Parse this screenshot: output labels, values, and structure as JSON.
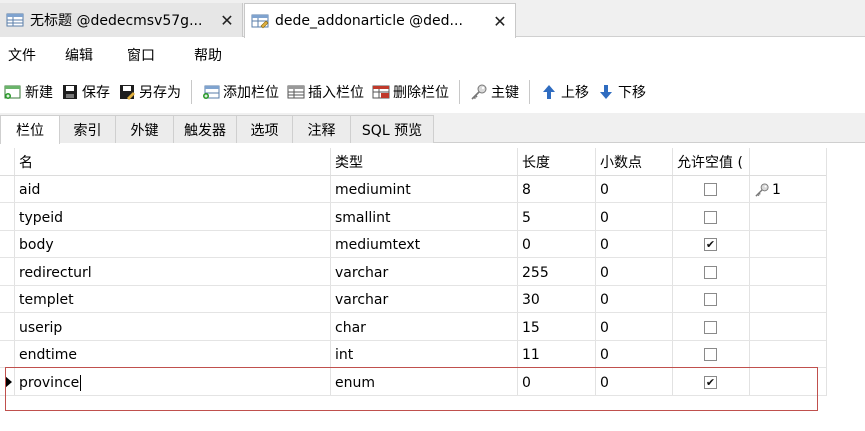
{
  "tabs": [
    {
      "label": "无标题 @dedecmsv57g...",
      "close": "✕"
    },
    {
      "label": "dede_addonarticle @ded...",
      "close": "✕"
    }
  ],
  "menu": [
    "文件",
    "编辑",
    "窗口",
    "帮助"
  ],
  "toolbar": {
    "new": "新建",
    "save": "保存",
    "save_as": "另存为",
    "add_column": "添加栏位",
    "insert_column": "插入栏位",
    "delete_column": "删除栏位",
    "primary_key": "主键",
    "move_up": "上移",
    "move_down": "下移"
  },
  "subtabs": [
    "栏位",
    "索引",
    "外键",
    "触发器",
    "选项",
    "注释",
    "SQL 预览"
  ],
  "grid": {
    "headers": {
      "name": "名",
      "type": "类型",
      "length": "长度",
      "decimals": "小数点",
      "allow_null": "允许空值 ("
    },
    "rows": [
      {
        "name": "aid",
        "type": "mediumint",
        "length": "8",
        "decimals": "0",
        "allow_null": false,
        "key": "1"
      },
      {
        "name": "typeid",
        "type": "smallint",
        "length": "5",
        "decimals": "0",
        "allow_null": false,
        "key": ""
      },
      {
        "name": "body",
        "type": "mediumtext",
        "length": "0",
        "decimals": "0",
        "allow_null": true,
        "key": ""
      },
      {
        "name": "redirecturl",
        "type": "varchar",
        "length": "255",
        "decimals": "0",
        "allow_null": false,
        "key": ""
      },
      {
        "name": "templet",
        "type": "varchar",
        "length": "30",
        "decimals": "0",
        "allow_null": false,
        "key": ""
      },
      {
        "name": "userip",
        "type": "char",
        "length": "15",
        "decimals": "0",
        "allow_null": false,
        "key": ""
      },
      {
        "name": "endtime",
        "type": "int",
        "length": "11",
        "decimals": "0",
        "allow_null": false,
        "key": ""
      },
      {
        "name": "province",
        "type": "enum",
        "length": "0",
        "decimals": "0",
        "allow_null": true,
        "key": ""
      }
    ]
  },
  "colors": {
    "selection_border": "#c0504d",
    "tab_bg": "#f0f0f0"
  }
}
